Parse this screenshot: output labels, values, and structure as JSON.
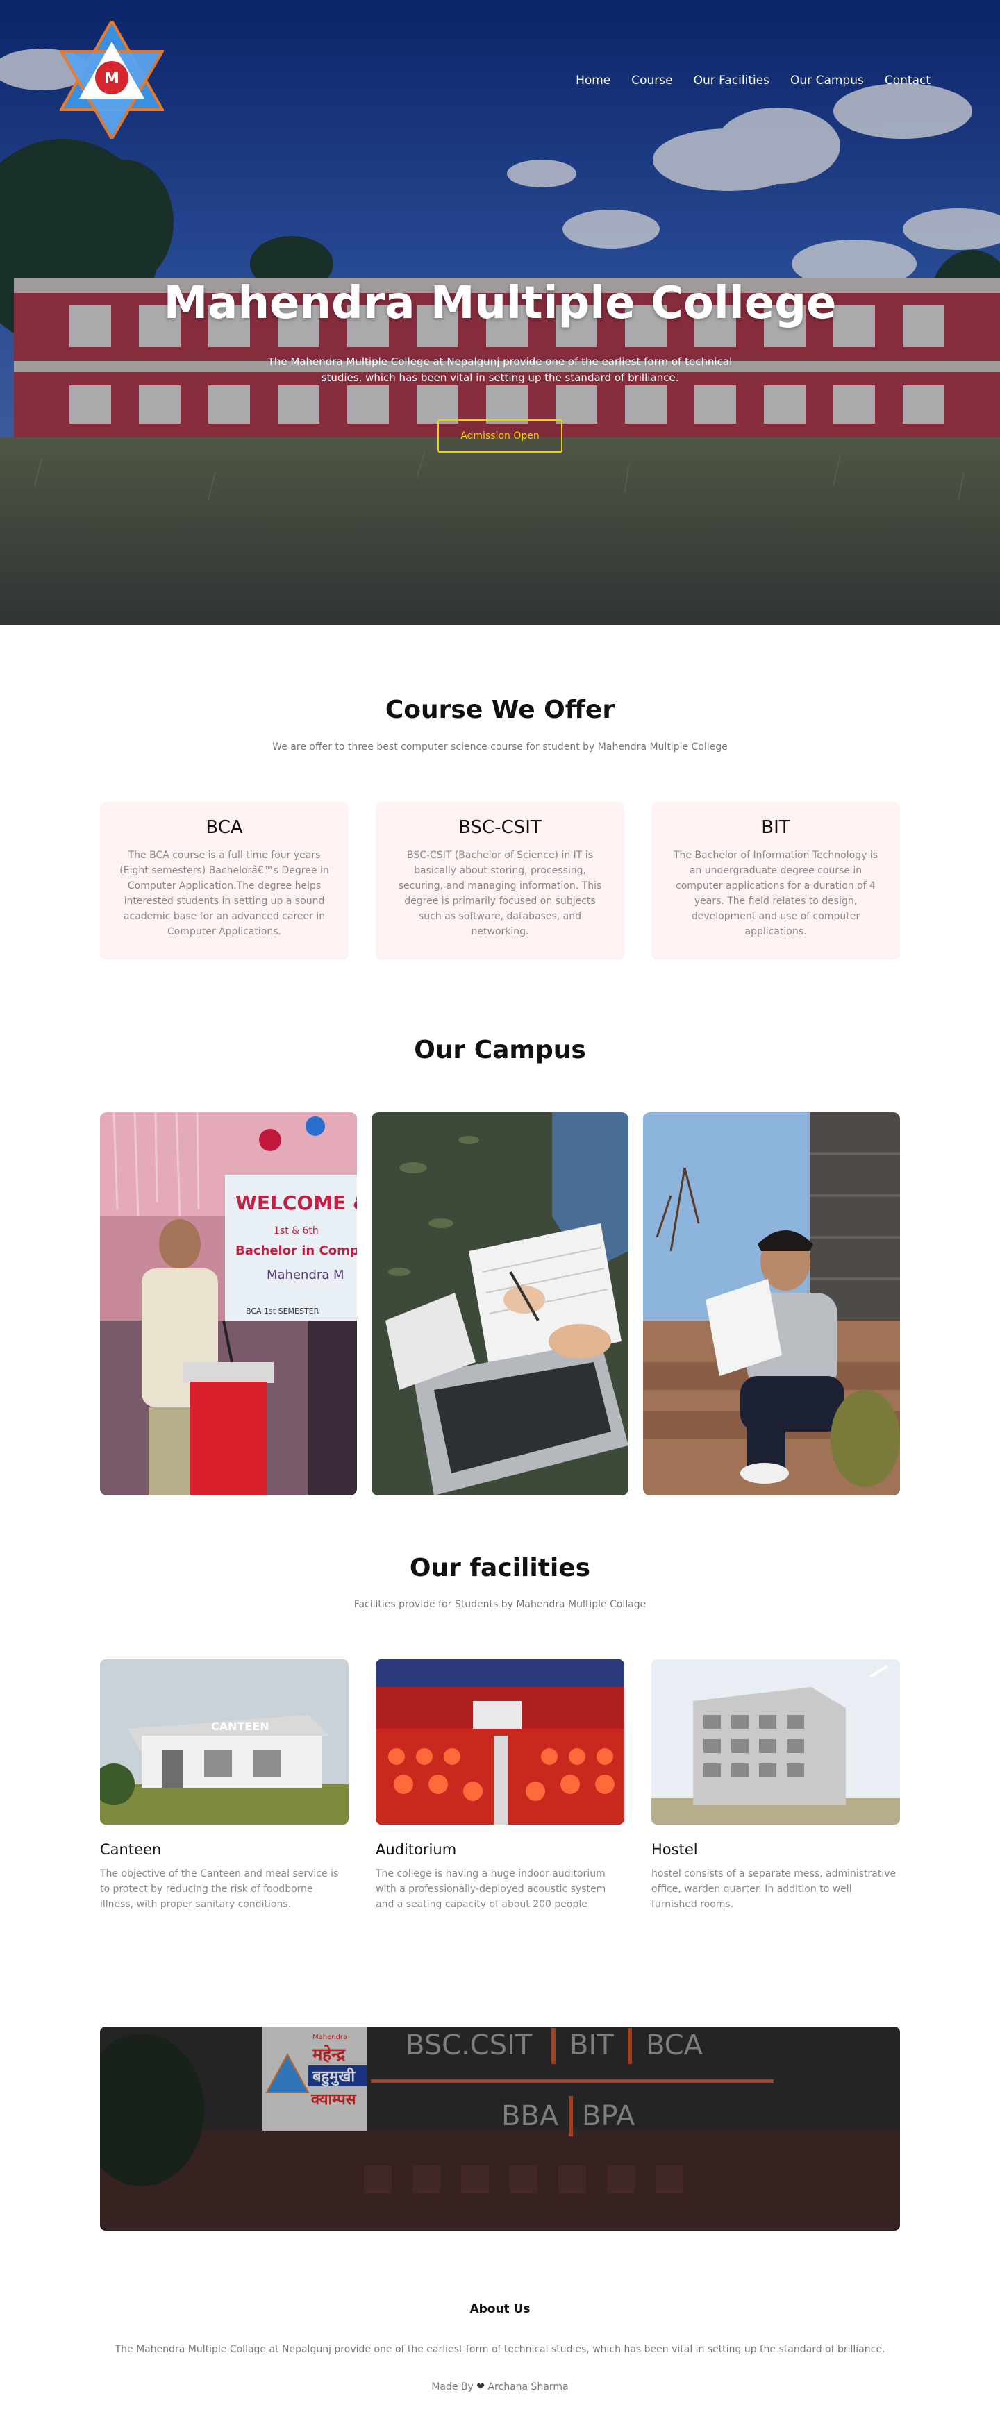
{
  "nav": {
    "items": [
      "Home",
      "Course",
      "Our Facilities",
      "Our Campus",
      "Contact"
    ]
  },
  "hero": {
    "title": "Mahendra Multiple College",
    "subtitle": "The Mahendra Multiple College at Nepalgunj provide one of the earliest form of technical studies, which has been vital in setting up the standard of brilliance.",
    "button": "Admission Open"
  },
  "courses": {
    "title": "Course We Offer",
    "subtitle": "We are offer to three best computer science course for student by Mahendra Multiple College",
    "items": [
      {
        "name": "BCA",
        "desc": "The BCA course is a full time four years (Eight semesters) Bachelorâ€™s Degree in Computer Application.The degree helps interested students in setting up a sound academic base for an advanced career in Computer Applications."
      },
      {
        "name": "BSC-CSIT",
        "desc": "BSC-CSIT (Bachelor of Science) in IT is basically about storing, processing, securing, and managing information. This degree is primarily focused on subjects such as software, databases, and networking."
      },
      {
        "name": "BIT",
        "desc": "The Bachelor of Information Technology is an undergraduate degree course in computer applications for a duration of 4 years. The field relates to design, development and use of computer applications."
      }
    ]
  },
  "campus": {
    "title": "Our Campus",
    "banner_text": [
      "WELCOME & FA",
      "1st & 6th",
      "Bachelor in Comp",
      "Mahendra M",
      "BCA 1st SEMESTER"
    ]
  },
  "facilities": {
    "title": "Our facilities",
    "subtitle": "Facilities provide for Students by Mahendra Multiple Collage",
    "canteen_sign": "CANTEEN",
    "items": [
      {
        "name": "Canteen",
        "desc": "The objective of the Canteen and meal service is to protect by reducing the risk of foodborne illness, with proper sanitary conditions."
      },
      {
        "name": "Auditorium",
        "desc": "The college is having a huge indoor auditorium with a professionally-deployed acoustic system and a seating capacity of about 200 people"
      },
      {
        "name": "Hostel",
        "desc": "hostel consists of a separate mess, administrative office, warden quarter. In addition to well furnished rooms."
      }
    ]
  },
  "banner": {
    "logo_top": "Mahendra",
    "logo_line1": "महेन्द्र",
    "logo_line2": "बहुमुखी",
    "logo_line3": "क्याम्पस",
    "row1": [
      "BSC.CSIT",
      "BIT",
      "BCA"
    ],
    "row2": [
      "BBA",
      "BPA"
    ]
  },
  "footer": {
    "about_title": "About Us",
    "about_text": "The Mahendra Multiple Collage at Nepalgunj provide one of the earliest form of technical studies, which has been vital in setting up the standard of brilliance.",
    "made_by_prefix": "Made By",
    "heart": "❤",
    "author": "Archana Sharma"
  },
  "colors": {
    "accent_yellow": "#e9d600",
    "card_bg": "#fff2f2",
    "banner_divider": "#c4502a"
  }
}
